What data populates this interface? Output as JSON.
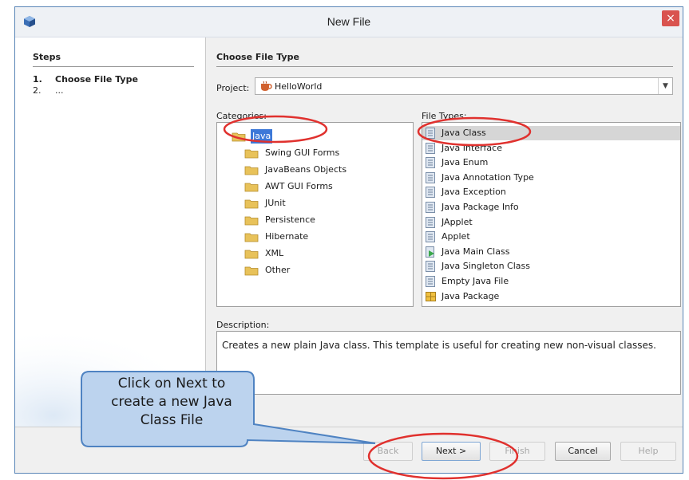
{
  "window": {
    "title": "New File",
    "close_glyph": "×"
  },
  "steps": {
    "title": "Steps",
    "items": [
      {
        "num": "1.",
        "label": "Choose File Type"
      },
      {
        "num": "2.",
        "label": "..."
      }
    ]
  },
  "main": {
    "title": "Choose File Type",
    "project_label": "Project:",
    "project_value": "HelloWorld",
    "categories_label": "Categories:",
    "filetypes_label": "File Types:",
    "categories": [
      "Java",
      "Swing GUI Forms",
      "JavaBeans Objects",
      "AWT GUI Forms",
      "JUnit",
      "Persistence",
      "Hibernate",
      "XML",
      "Other"
    ],
    "selected_category": "Java",
    "file_types": [
      "Java Class",
      "Java Interface",
      "Java Enum",
      "Java Annotation Type",
      "Java Exception",
      "Java Package Info",
      "JApplet",
      "Applet",
      "Java Main Class",
      "Java Singleton Class",
      "Empty Java File",
      "Java Package"
    ],
    "selected_file_type": "Java Class",
    "description_label": "Description:",
    "description_text": "Creates a new plain Java class. This template is useful for creating new non-visual classes."
  },
  "buttons": {
    "back": "Back",
    "next": "Next >",
    "finish": "Finish",
    "cancel": "Cancel",
    "help": "Help"
  },
  "annotation": {
    "callout_lines": [
      "Click on Next to",
      "create a new Java",
      "Class File"
    ],
    "highlight_color": "#e0312e",
    "callout_fill": "#bcd3ee",
    "callout_border": "#4f83c2"
  },
  "colors": {
    "selection": "#3c78d8",
    "folder": "#e8c25a",
    "window_border": "#5a86b7"
  },
  "icons": {
    "app": "netbeans-cube-icon",
    "project": "coffee-cup-project-icon",
    "category": "folder-icon",
    "file_type": "java-file-icon"
  }
}
